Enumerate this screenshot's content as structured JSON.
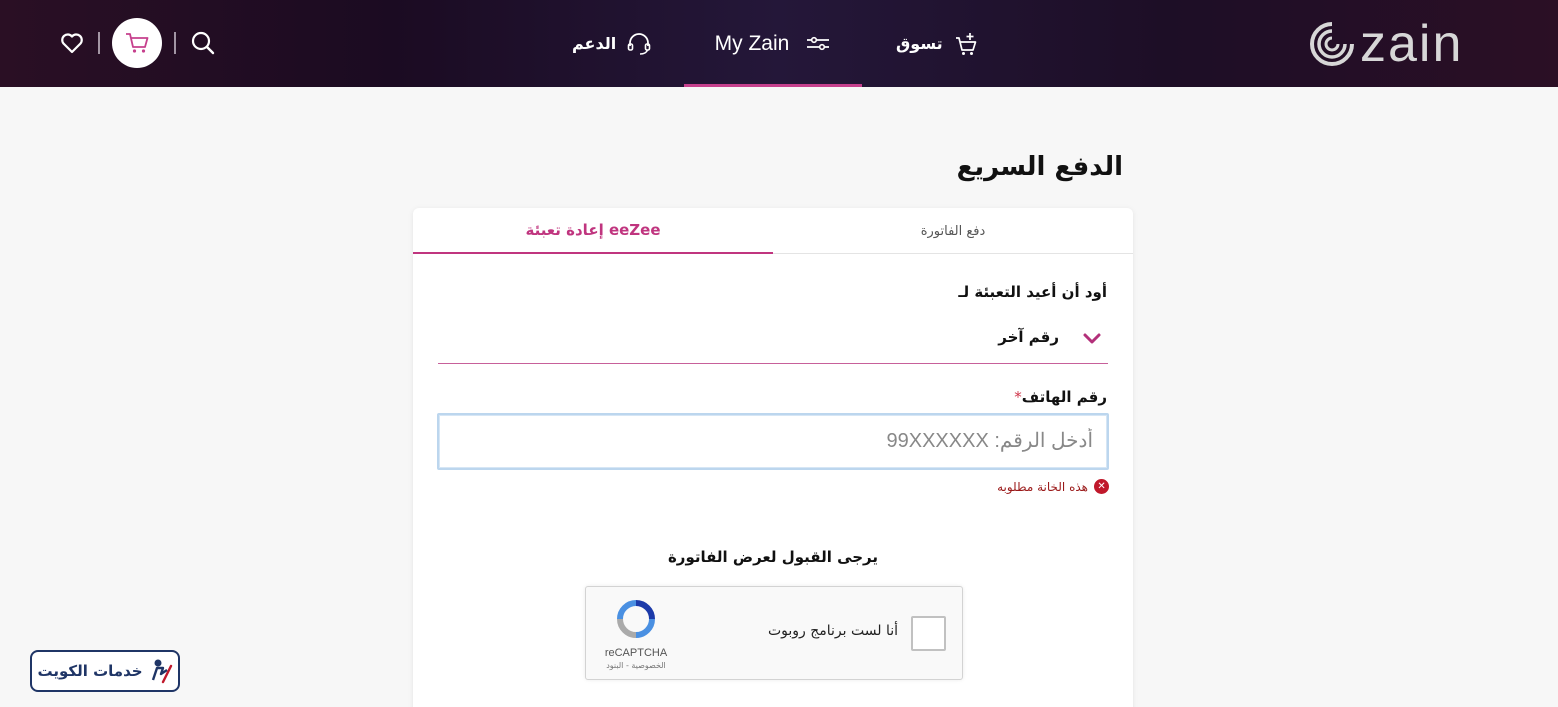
{
  "header": {
    "nav": {
      "shop_label": "تسوق",
      "myzain_label": "My Zain",
      "support_label": "الدعم"
    },
    "logo_text": "zain",
    "icons": [
      "heart-icon",
      "cart-icon",
      "search-icon",
      "headset-icon",
      "menu-lines-icon",
      "cart-plus-icon"
    ]
  },
  "page": {
    "title": "الدفع السريع"
  },
  "tabs": [
    {
      "label": "إعادة تعبئة eeZee",
      "active": true
    },
    {
      "label": "دفع الفاتورة",
      "active": false
    }
  ],
  "form": {
    "recharge_for_label": "أود أن أعيد التعبئة لـ",
    "recharge_for_value": "رقم آخر",
    "phone_label": "رقم الهاتف",
    "required_mark": "*",
    "phone_placeholder": "أدخل الرقم: 99XXXXXX",
    "phone_value": "",
    "error_text": "هذه الخانة مطلوبه",
    "accept_text": "يرجى القبول لعرض الفاتورة"
  },
  "captcha": {
    "label": "أنا لست برنامج روبوت",
    "brand": "reCAPTCHA",
    "links": "الخصوصية - البنود"
  },
  "watermark": {
    "text": "خدمات الكويت"
  },
  "colors": {
    "accent": "#c0357f",
    "header_bg": "#1f0d24",
    "error": "#c0182b"
  }
}
